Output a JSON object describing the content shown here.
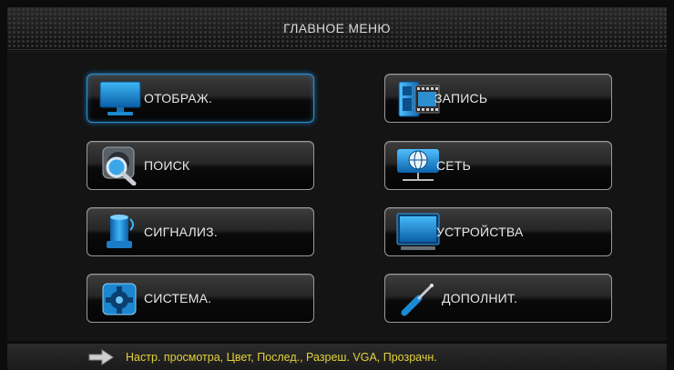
{
  "header": {
    "title": "ГЛАВНОЕ МЕНЮ"
  },
  "menu": {
    "items": [
      {
        "label": "ОТОБРАЖ.",
        "icon": "monitor-icon",
        "selected": true
      },
      {
        "label": "ЗАПИСЬ",
        "icon": "record-film-icon",
        "selected": false
      },
      {
        "label": "ПОИСК",
        "icon": "search-magnifier-icon",
        "selected": false
      },
      {
        "label": "СЕТЬ",
        "icon": "network-globe-icon",
        "selected": false
      },
      {
        "label": "СИГНАЛИЗ.",
        "icon": "alarm-siren-icon",
        "selected": false
      },
      {
        "label": "УСТРОЙСТВА",
        "icon": "devices-monitor-icon",
        "selected": false
      },
      {
        "label": "СИСТЕМА.",
        "icon": "system-gear-icon",
        "selected": false
      },
      {
        "label": "ДОПОЛНИТ.",
        "icon": "tools-screwdriver-icon",
        "selected": false
      }
    ]
  },
  "status": {
    "text": "Настр. просмотра, Цвет, Послед., Разреш. VGA, Прозрачн.",
    "icon": "arrow-right-icon",
    "text_color": "#e4d23a"
  },
  "colors": {
    "accent": "#2d8fd0",
    "icon_blue": "#1e9be0"
  }
}
